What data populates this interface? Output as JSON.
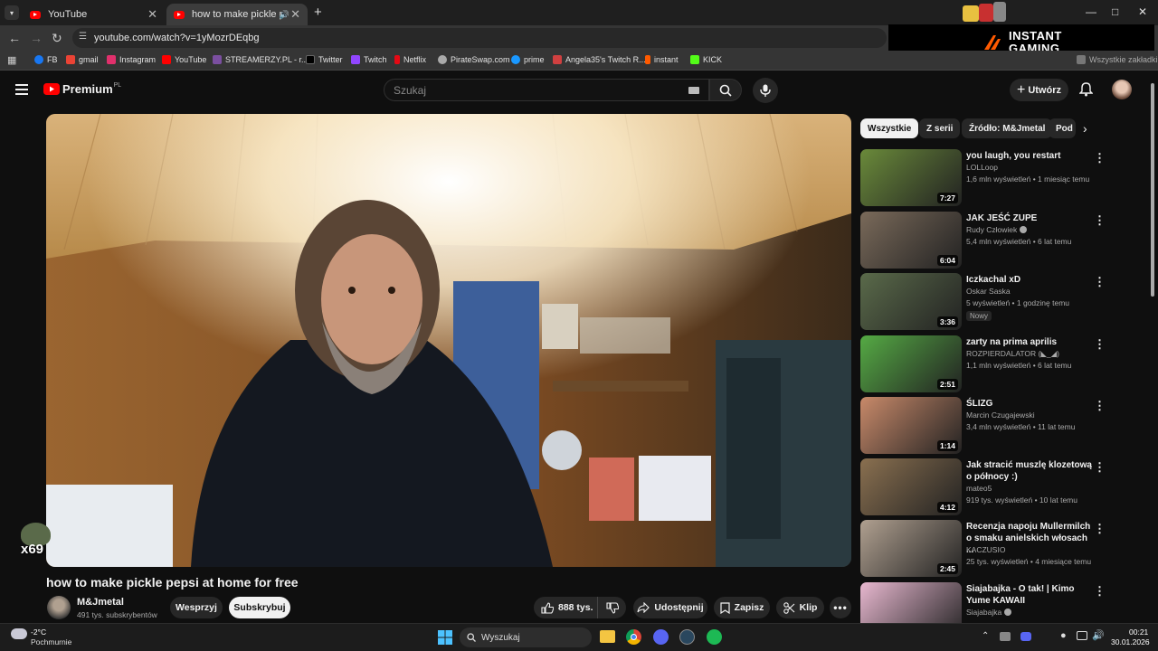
{
  "browser": {
    "tabs": [
      {
        "title": "YouTube",
        "active": false
      },
      {
        "title": "how to make pickle pepsi at home for free",
        "active": true
      }
    ],
    "new_tab": "+",
    "url": "youtube.com/watch?v=1yMozrDEqbg",
    "bookmarks": [
      {
        "label": "FB",
        "color": "#1877f2"
      },
      {
        "label": "gmail",
        "color": "#ea4335"
      },
      {
        "label": "Instagram",
        "color": "#e1306c"
      },
      {
        "label": "YouTube",
        "color": "#ff0000"
      },
      {
        "label": "STREAMERZY.PL - r...",
        "color": "#7b4fa0"
      },
      {
        "label": "Twitter",
        "color": "#000000"
      },
      {
        "label": "Twitch",
        "color": "#9146ff"
      },
      {
        "label": "Netflix",
        "color": "#e50914"
      },
      {
        "label": "PirateSwap.com",
        "color": "#aaaaaa"
      },
      {
        "label": "prime",
        "color": "#1a98ff"
      },
      {
        "label": "Angela35's Twitch R...",
        "color": "#d04040"
      },
      {
        "label": "instant",
        "color": "#ff5a00"
      },
      {
        "label": "KICK",
        "color": "#53fc18"
      }
    ],
    "overflow_bookmarks": "Wszystkie zakładki"
  },
  "ad": {
    "line1": "INSTANT",
    "line2": "GAMING",
    "accent": "#ff5a00"
  },
  "youtube": {
    "logo": "Premium",
    "region": "PL",
    "search_placeholder": "Szukaj",
    "create_label": "Utwórz",
    "video_title": "how to make pickle pepsi at home for free",
    "overlay_text": "x69",
    "channel": {
      "name": "M&Jmetal",
      "subs": "491 tys. subskrybentów"
    },
    "support_label": "Wesprzyj",
    "subscribe_label": "Subskrybuj",
    "likes": "888 tys.",
    "share_label": "Udostępnij",
    "save_label": "Zapisz",
    "clip_label": "Klip",
    "chips": [
      "Wszystkie",
      "Z serii",
      "Źródło: M&Jmetal",
      "Pod"
    ],
    "recommendations": [
      {
        "title": "you laugh, you restart",
        "channel": "LOLLoop",
        "meta": "1,6 mln wyświetleń • 1 miesiąc temu",
        "duration": "7:27",
        "thumb": "#6a8a3a",
        "verified": false,
        "badge": ""
      },
      {
        "title": "JAK JEŚĆ ZUPE",
        "channel": "Rudy Człowiek",
        "meta": "5,4 mln wyświetleń • 6 lat temu",
        "duration": "6:04",
        "thumb": "#7a6a5a",
        "verified": true,
        "badge": ""
      },
      {
        "title": "Iczkachal xD",
        "channel": "Oskar Saska",
        "meta": "5 wyświetleń • 1 godzinę temu",
        "duration": "3:36",
        "thumb": "#5a6a4a",
        "verified": false,
        "badge": "Nowy"
      },
      {
        "title": "zarty na prima aprilis",
        "channel": "ROZPIERDALATOR (◣_◢)",
        "meta": "1,1 mln wyświetleń • 6 lat temu",
        "duration": "2:51",
        "thumb": "#55aa44",
        "verified": false,
        "badge": ""
      },
      {
        "title": "ŚLIZG",
        "channel": "Marcin Czugajewski",
        "meta": "3,4 mln wyświetleń • 11 lat temu",
        "duration": "1:14",
        "thumb": "#c98a6a",
        "verified": false,
        "badge": ""
      },
      {
        "title": "Jak stracić muszlę klozetową o północy :)",
        "channel": "mateo5",
        "meta": "919 tys. wyświetleń • 10 lat temu",
        "duration": "4:12",
        "thumb": "#8a7050",
        "verified": false,
        "badge": ""
      },
      {
        "title": "Recenzja napoju Mullermilch o smaku anielskich włosach ...",
        "channel": "KACZUSIO",
        "meta": "25 tys. wyświetleń • 4 miesiące temu",
        "duration": "2:45",
        "thumb": "#b0a090",
        "verified": false,
        "badge": ""
      },
      {
        "title": "Siajabajka - O tak! | Kimo Yume KAWAII",
        "channel": "Siajabajka",
        "meta": "",
        "duration": "",
        "thumb": "#e8b8d0",
        "verified": true,
        "badge": ""
      }
    ]
  },
  "taskbar": {
    "weather_temp": "-2°C",
    "weather_desc": "Pochmurnie",
    "search_label": "Wyszukaj",
    "time": "00:21",
    "date": "30.01.2026"
  }
}
